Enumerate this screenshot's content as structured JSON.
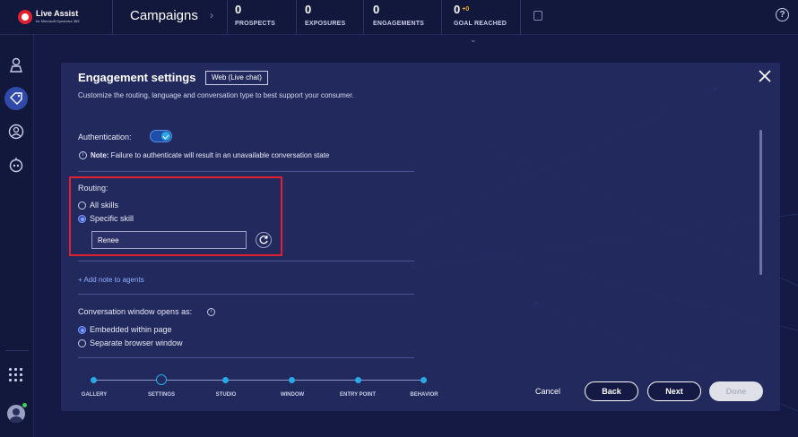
{
  "topbar": {
    "logo_text": "Live Assist",
    "logo_sub": "for Microsoft Dynamics 365",
    "title": "Campaigns",
    "stats": [
      {
        "value": "0",
        "label": "PROSPECTS",
        "plus": ""
      },
      {
        "value": "0",
        "label": "EXPOSURES",
        "plus": ""
      },
      {
        "value": "0",
        "label": "ENGAGEMENTS",
        "plus": ""
      },
      {
        "value": "0",
        "label": "GOAL REACHED",
        "plus": "+0"
      }
    ],
    "help_glyph": "?"
  },
  "sidebar": {
    "icons": [
      "agent-icon",
      "tag-icon",
      "user-circle-icon",
      "robot-icon",
      "apps-grid-icon",
      "avatar"
    ]
  },
  "panel": {
    "title": "Engagement settings",
    "badge": "Web (Live chat)",
    "subtitle": "Customize the routing, language and conversation type to best support your consumer.",
    "authentication_label": "Authentication:",
    "authentication_on": true,
    "note_prefix": "Note:",
    "note_text": " Failure to authenticate will result in an unavailable conversation state",
    "routing_label": "Routing:",
    "routing_options": [
      "All skills",
      "Specific skill"
    ],
    "routing_selected": "Specific skill",
    "skill_value": "Renee",
    "add_note_label": "+ Add note to agents",
    "window_label": "Conversation window opens as:",
    "window_options": [
      "Embedded within page",
      "Separate browser window"
    ],
    "window_selected": "Embedded within page"
  },
  "stepper": {
    "steps": [
      "GALLERY",
      "SETTINGS",
      "STUDIO",
      "WINDOW",
      "ENTRY POINT",
      "BEHAVIOR"
    ],
    "current": "SETTINGS"
  },
  "footer": {
    "cancel": "Cancel",
    "back": "Back",
    "next": "Next",
    "done": "Done"
  },
  "colors": {
    "accent": "#29a8e8",
    "highlight": "#e0202e",
    "link": "#8fb0ff",
    "panel_bg": "#232b61"
  }
}
